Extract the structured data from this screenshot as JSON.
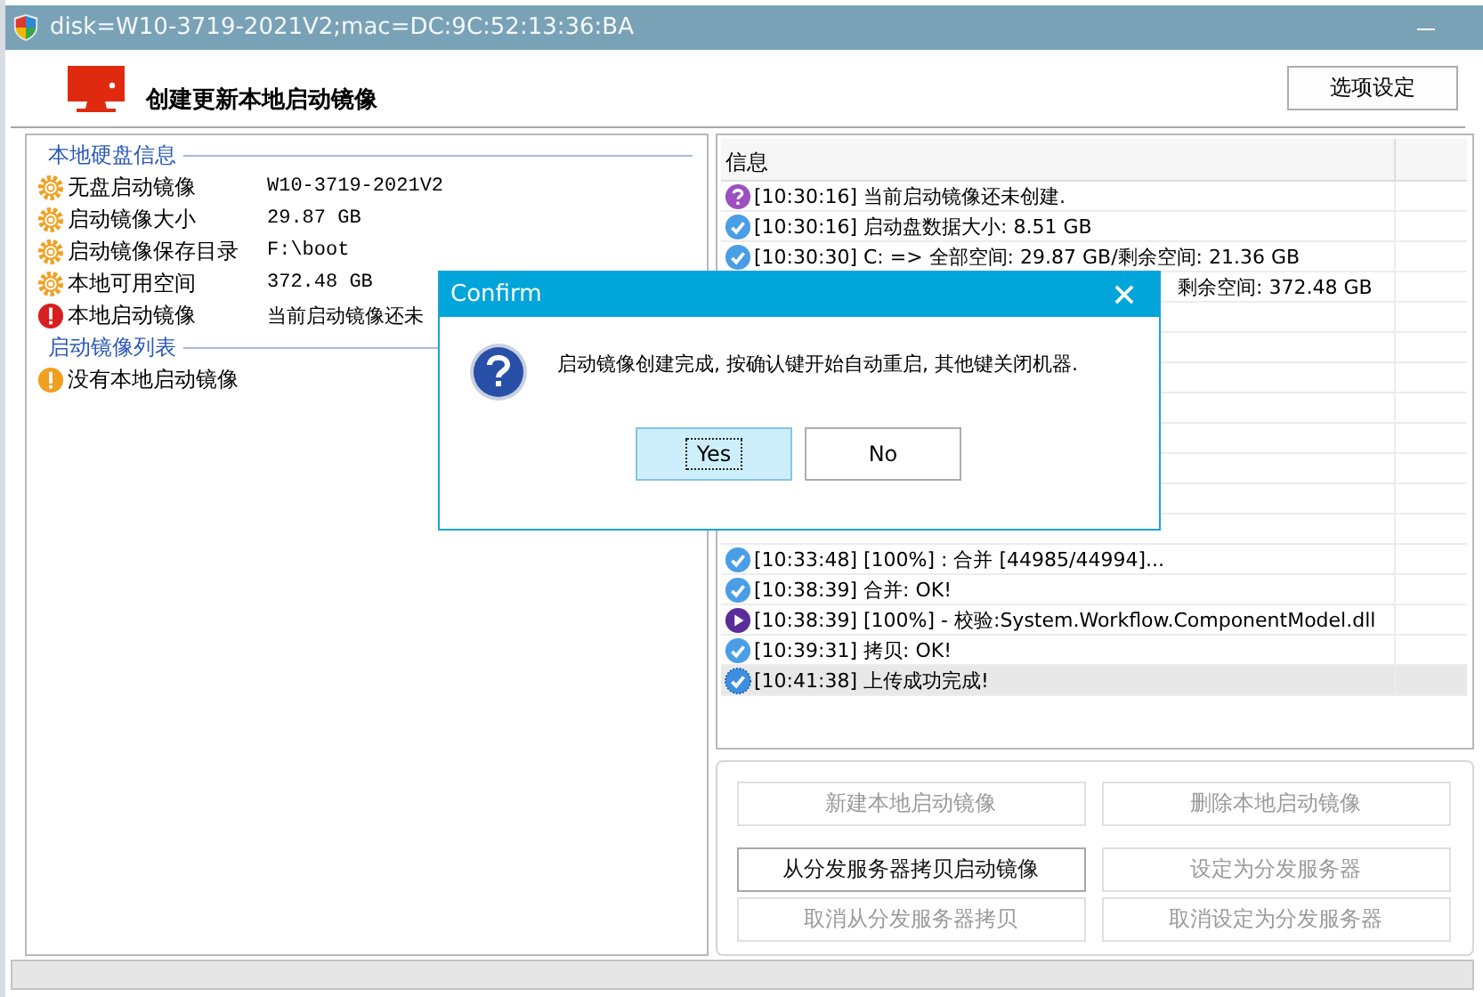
{
  "window": {
    "title": "disk=W10-3719-2021V2;mac=DC:9C:52:13:36:BA"
  },
  "header": {
    "title": "创建更新本地启动镜像",
    "options_button": "选项设定"
  },
  "local_disk": {
    "heading": "本地硬盘信息",
    "rows": [
      {
        "kind": "info",
        "label": "无盘启动镜像",
        "value": "W10-3719-2021V2"
      },
      {
        "kind": "info",
        "label": "启动镜像大小",
        "value": "29.87 GB"
      },
      {
        "kind": "info",
        "label": "启动镜像保存目录",
        "value": "F:\\boot"
      },
      {
        "kind": "info",
        "label": "本地可用空间",
        "value": "372.48 GB"
      },
      {
        "kind": "error",
        "label": "本地启动镜像",
        "value": "当前启动镜像还未"
      }
    ]
  },
  "image_list": {
    "heading": "启动镜像列表",
    "rows": [
      {
        "kind": "warning",
        "label": "没有本地启动镜像"
      }
    ]
  },
  "log": {
    "columns": [
      "信息"
    ],
    "top_rows": [
      {
        "kind": "question",
        "text": "[10:30:16] 当前启动镜像还未创建.",
        "selected": false
      },
      {
        "kind": "check",
        "text": "[10:30:16] 启动盘数据大小: 8.51 GB",
        "selected": false
      },
      {
        "kind": "check",
        "text": "[10:30:30] C: => 全部空间: 29.87 GB/剩余空间: 21.36 GB",
        "selected": false
      },
      {
        "kind": "partial",
        "text": "剩余空间: 372.48 GB",
        "selected": false
      }
    ],
    "bottom_rows": [
      {
        "kind": "check",
        "text": "[10:33:48] [100%] : 合并 [44985/44994]...",
        "selected": false
      },
      {
        "kind": "check",
        "text": "[10:38:39] 合并: OK!",
        "selected": false
      },
      {
        "kind": "play",
        "text": "[10:38:39] [100%] - 校验:System.Workflow.ComponentModel.dll",
        "selected": false
      },
      {
        "kind": "check",
        "text": "[10:39:31] 拷贝: OK!",
        "selected": false
      },
      {
        "kind": "check",
        "text": "[10:41:38] 上传成功完成!",
        "selected": true
      }
    ]
  },
  "actions": [
    {
      "label": "新建本地启动镜像",
      "disabled": true
    },
    {
      "label": "删除本地启动镜像",
      "disabled": true
    },
    {
      "label": "从分发服务器拷贝启动镜像",
      "disabled": false
    },
    {
      "label": "设定为分发服务器",
      "disabled": true
    },
    {
      "label": "取消从分发服务器拷贝",
      "disabled": true
    },
    {
      "label": "取消设定为分发服务器",
      "disabled": true
    }
  ],
  "dialog": {
    "title": "Confirm",
    "message": "启动镜像创建完成, 按确认键开始自动重启, 其他键关闭机器.",
    "buttons": [
      {
        "label": "Yes",
        "selected": true
      },
      {
        "label": "No",
        "selected": false
      }
    ]
  }
}
